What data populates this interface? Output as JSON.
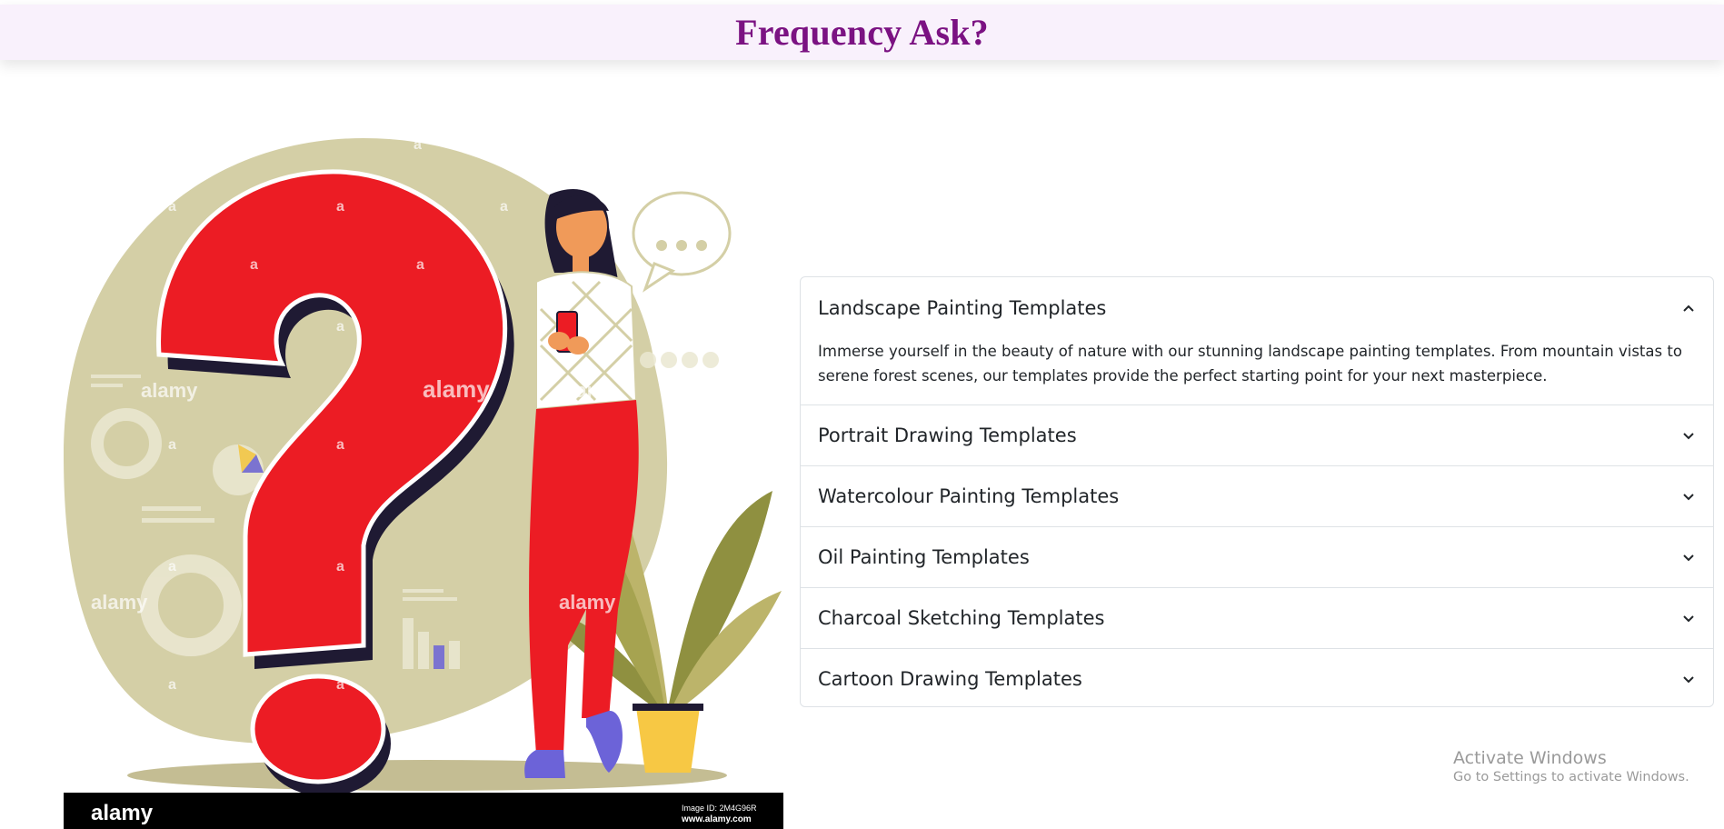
{
  "header": {
    "title": "Frequency Ask?"
  },
  "illustration": {
    "watermark_brand": "alamy",
    "watermark_letter": "a",
    "stock_id": "Image ID: 2M4G96R",
    "stock_url": "www.alamy.com",
    "colors": {
      "blob": "#d4cfa6",
      "question_mark": "#ec1c24",
      "shadow": "#1f1a33",
      "shoes": "#6c63d8",
      "pot": "#f7c844",
      "plant_dark": "#8f9040",
      "plant_light": "#bcb46a"
    }
  },
  "faq": {
    "items": [
      {
        "title": "Landscape Painting Templates",
        "expanded": true,
        "body": "Immerse yourself in the beauty of nature with our stunning landscape painting templates. From mountain vistas to serene forest scenes, our templates provide the perfect starting point for your next masterpiece."
      },
      {
        "title": "Portrait Drawing Templates",
        "expanded": false
      },
      {
        "title": "Watercolour Painting Templates",
        "expanded": false
      },
      {
        "title": "Oil Painting Templates",
        "expanded": false
      },
      {
        "title": "Charcoal Sketching Templates",
        "expanded": false
      },
      {
        "title": "Cartoon Drawing Templates",
        "expanded": false
      }
    ]
  },
  "os_watermark": {
    "line1": "Activate Windows",
    "line2": "Go to Settings to activate Windows."
  }
}
